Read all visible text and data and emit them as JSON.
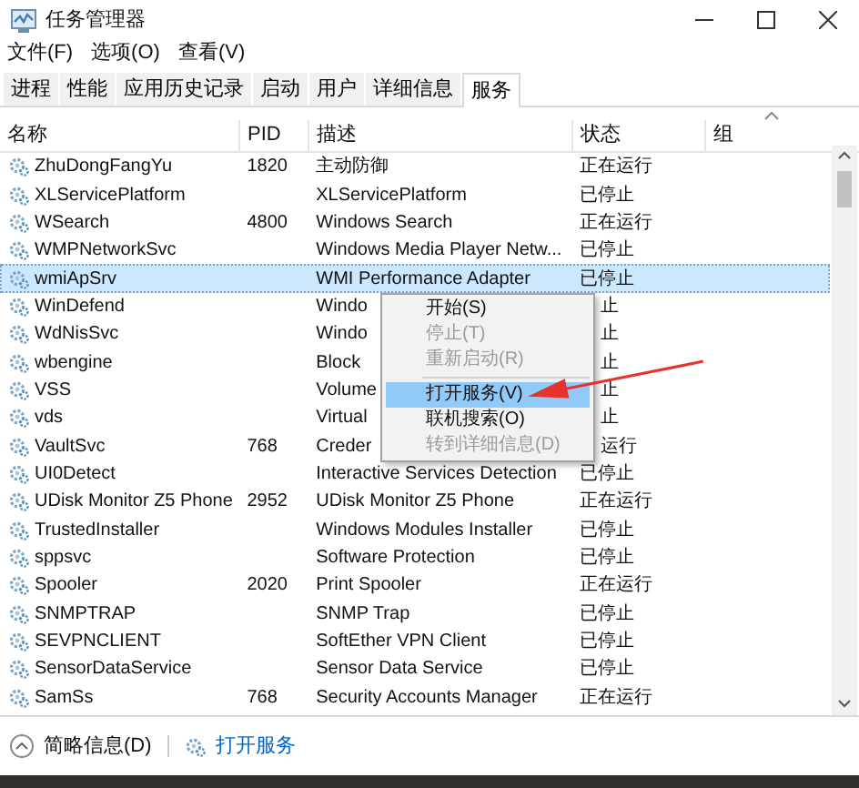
{
  "window": {
    "title": "任务管理器"
  },
  "menu": [
    "文件(F)",
    "选项(O)",
    "查看(V)"
  ],
  "tabs": [
    {
      "label": "进程",
      "selected": false
    },
    {
      "label": "性能",
      "selected": false
    },
    {
      "label": "应用历史记录",
      "selected": false
    },
    {
      "label": "启动",
      "selected": false
    },
    {
      "label": "用户",
      "selected": false
    },
    {
      "label": "详细信息",
      "selected": false
    },
    {
      "label": "服务",
      "selected": true
    }
  ],
  "table": {
    "columns": [
      "名称",
      "PID",
      "描述",
      "状态",
      "组"
    ],
    "rows": [
      {
        "name": "ZhuDongFangYu",
        "pid": "1820",
        "description": "主动防御",
        "status": "正在运行",
        "selected": false,
        "covered": false
      },
      {
        "name": "XLServicePlatform",
        "description": "XLServicePlatform",
        "status": "已停止",
        "selected": false,
        "covered": false
      },
      {
        "name": "WSearch",
        "pid": "4800",
        "description": "Windows Search",
        "status": "正在运行",
        "selected": false,
        "covered": false
      },
      {
        "name": "WMPNetworkSvc",
        "description": "Windows Media Player Netw...",
        "status": "已停止",
        "selected": false,
        "covered": false
      },
      {
        "name": "wmiApSrv",
        "description": "WMI Performance Adapter",
        "status": "已停止",
        "selected": true,
        "covered": false
      },
      {
        "name": "WinDefend",
        "description": "Windo",
        "status": "止",
        "selected": false,
        "covered": true
      },
      {
        "name": "WdNisSvc",
        "description": "Windo",
        "status": "止",
        "selected": false,
        "covered": true
      },
      {
        "name": "wbengine",
        "description": "Block",
        "status": "止",
        "selected": false,
        "covered": true
      },
      {
        "name": "VSS",
        "description": "Volume",
        "status": "止",
        "selected": false,
        "covered": true
      },
      {
        "name": "vds",
        "description": "Virtual",
        "status": "止",
        "selected": false,
        "covered": true
      },
      {
        "name": "VaultSvc",
        "pid": "768",
        "description": "Creder",
        "status": "运行",
        "selected": false,
        "covered": true
      },
      {
        "name": "UI0Detect",
        "description": "Interactive Services Detection",
        "status": "已停止",
        "selected": false,
        "covered": false
      },
      {
        "name": "UDisk Monitor Z5 Phone",
        "pid": "2952",
        "description": "UDisk Monitor Z5 Phone",
        "status": "正在运行",
        "selected": false,
        "covered": false
      },
      {
        "name": "TrustedInstaller",
        "description": "Windows Modules Installer",
        "status": "已停止",
        "selected": false,
        "covered": false
      },
      {
        "name": "sppsvc",
        "description": "Software Protection",
        "status": "已停止",
        "selected": false,
        "covered": false
      },
      {
        "name": "Spooler",
        "pid": "2020",
        "description": "Print Spooler",
        "status": "正在运行",
        "selected": false,
        "covered": false
      },
      {
        "name": "SNMPTRAP",
        "description": "SNMP Trap",
        "status": "已停止",
        "selected": false,
        "covered": false
      },
      {
        "name": "SEVPNCLIENT",
        "description": "SoftEther VPN Client",
        "status": "已停止",
        "selected": false,
        "covered": false
      },
      {
        "name": "SensorDataService",
        "description": "Sensor Data Service",
        "status": "已停止",
        "selected": false,
        "covered": false
      },
      {
        "name": "SamSs",
        "pid": "768",
        "description": "Security Accounts Manager",
        "status": "正在运行",
        "selected": false,
        "covered": false
      }
    ]
  },
  "context_menu": [
    {
      "kind": "item",
      "label": "开始(S)",
      "disabled": false,
      "selected": false
    },
    {
      "kind": "item",
      "label": "停止(T)",
      "disabled": true,
      "selected": false
    },
    {
      "kind": "item",
      "label": "重新启动(R)",
      "disabled": true,
      "selected": false
    },
    {
      "kind": "separator"
    },
    {
      "kind": "item",
      "label": "打开服务(V)",
      "disabled": false,
      "selected": true
    },
    {
      "kind": "item",
      "label": "联机搜索(O)",
      "disabled": false,
      "selected": false
    },
    {
      "kind": "item",
      "label": "转到详细信息(D)",
      "disabled": true,
      "selected": false
    }
  ],
  "footer": {
    "details_toggle": "简略信息(D)",
    "open_services": "打开服务"
  }
}
